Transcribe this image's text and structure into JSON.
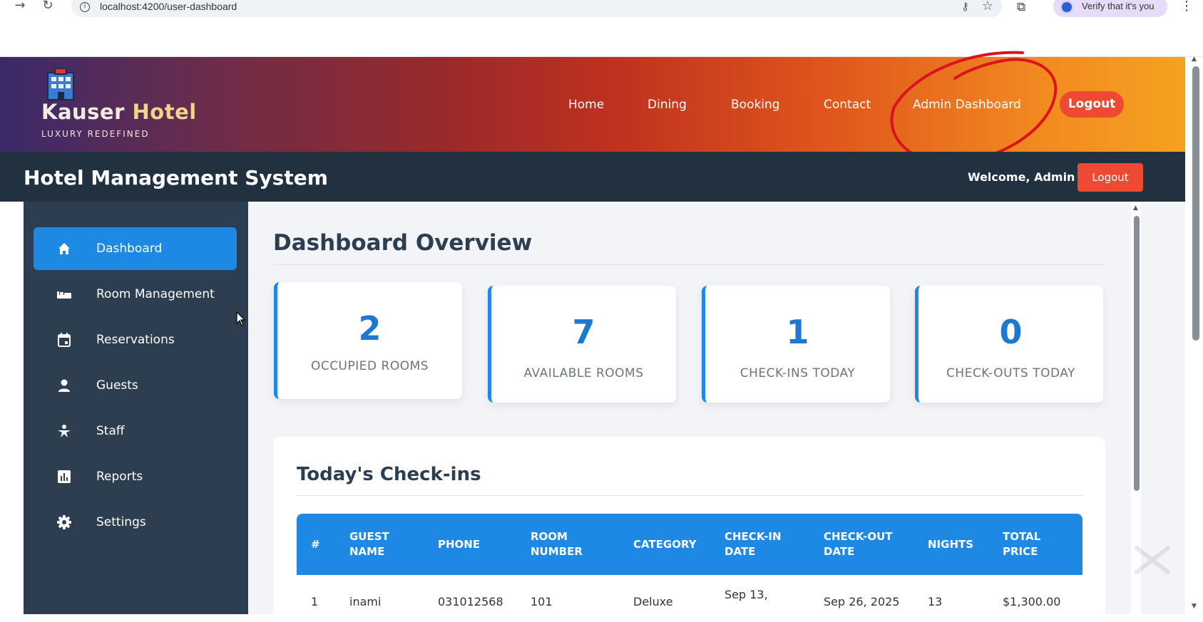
{
  "browser": {
    "url": "localhost:4200/user-dashboard",
    "profile_label": "Verify that it's you"
  },
  "hotel_header": {
    "brand_first": "Kauser",
    "brand_second": "Hotel",
    "tagline": "LUXURY REDEFINED",
    "nav": [
      "Home",
      "Dining",
      "Booking",
      "Contact",
      "Admin Dashboard"
    ],
    "logout_label": "Logout"
  },
  "app_bar": {
    "title": "Hotel Management System",
    "welcome": "Welcome, Admin",
    "logout_label": "Logout"
  },
  "sidebar": {
    "items": [
      {
        "label": "Dashboard",
        "icon": "home-icon",
        "active": true
      },
      {
        "label": "Room Management",
        "icon": "bed-icon",
        "active": false
      },
      {
        "label": "Reservations",
        "icon": "calendar-icon",
        "active": false
      },
      {
        "label": "Guests",
        "icon": "person-icon",
        "active": false
      },
      {
        "label": "Staff",
        "icon": "staff-icon",
        "active": false
      },
      {
        "label": "Reports",
        "icon": "chart-icon",
        "active": false
      },
      {
        "label": "Settings",
        "icon": "gear-icon",
        "active": false
      }
    ]
  },
  "main": {
    "title": "Dashboard Overview",
    "stats": [
      {
        "value": "2",
        "label": "OCCUPIED ROOMS"
      },
      {
        "value": "7",
        "label": "AVAILABLE ROOMS"
      },
      {
        "value": "1",
        "label": "CHECK-INS TODAY"
      },
      {
        "value": "0",
        "label": "CHECK-OUTS TODAY"
      }
    ],
    "checkins": {
      "title": "Today's Check-ins",
      "columns": [
        {
          "line1": "#",
          "line2": ""
        },
        {
          "line1": "GUEST",
          "line2": "NAME"
        },
        {
          "line1": "PHONE",
          "line2": ""
        },
        {
          "line1": "ROOM",
          "line2": "NUMBER"
        },
        {
          "line1": "CATEGORY",
          "line2": ""
        },
        {
          "line1": "CHECK-IN",
          "line2": "DATE"
        },
        {
          "line1": "CHECK-OUT",
          "line2": "DATE"
        },
        {
          "line1": "NIGHTS",
          "line2": ""
        },
        {
          "line1": "TOTAL",
          "line2": "PRICE"
        }
      ],
      "rows": [
        [
          "1",
          "inami",
          "031012568",
          "101",
          "Deluxe",
          "Sep 13,",
          "Sep 26, 2025",
          "13",
          "$1,300.00"
        ]
      ]
    }
  },
  "colors": {
    "accent": "#1e88e5",
    "danger": "#ee4a33",
    "sidebar": "#2c3e50",
    "app_bar": "#22313f"
  }
}
